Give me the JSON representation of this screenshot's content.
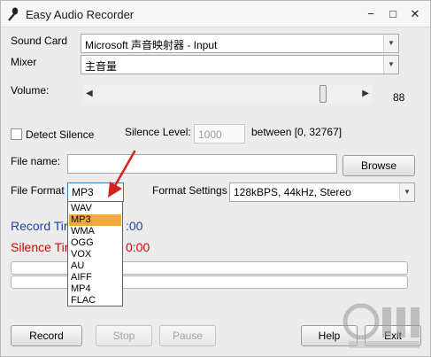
{
  "window": {
    "title": "Easy Audio Recorder",
    "minimize_glyph": "−",
    "restore_glyph": "□",
    "close_glyph": "✕",
    "icon": "microphone-icon"
  },
  "sound_card": {
    "label": "Sound Card",
    "value": "Microsoft 声音映射器 - Input"
  },
  "mixer": {
    "label": "Mixer",
    "value": "主音量"
  },
  "volume": {
    "label": "Volume:",
    "value_text": "88",
    "level_fraction": 0.88,
    "left_arrow": "◀",
    "right_arrow": "▶"
  },
  "silence": {
    "detect_label": "Detect Silence",
    "level_label": "Silence Level:",
    "level_value": "1000",
    "range_text": "between [0, 32767]"
  },
  "file": {
    "label": "File name:",
    "value": "",
    "browse_label": "Browse"
  },
  "format": {
    "label": "File Format",
    "selected": "MP3",
    "options": [
      "WAV",
      "MP3",
      "WMA",
      "OGG",
      "VOX",
      "AU",
      "AIFF",
      "MP4",
      "FLAC"
    ],
    "highlighted_index": 1,
    "settings_label": "Format Settings",
    "settings_value": "128kBPS, 44kHz, Stereo"
  },
  "record_time": {
    "label": "Record Tim",
    "value": ":00",
    "color": "#1f3fa8"
  },
  "silence_time": {
    "label": "Silence Tim",
    "value": "0:00",
    "color": "#d40000"
  },
  "buttons": {
    "record": "Record",
    "stop": "Stop",
    "pause": "Pause",
    "help": "Help",
    "exit": "Exit"
  },
  "colors": {
    "highlight": "#f2a83a",
    "pointer_arrow": "#d42020"
  },
  "watermark": {
    "icon": "watermark-logo-icon"
  }
}
